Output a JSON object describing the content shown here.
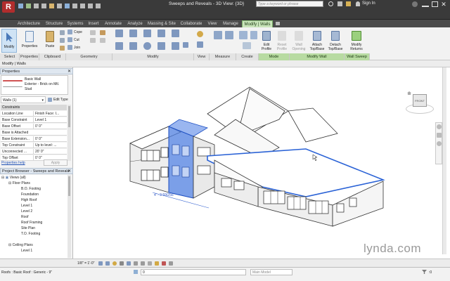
{
  "app": {
    "title": "Sweeps and Reveals - 3D View: {3D}",
    "search_placeholder": "Type a keyword or phrase",
    "sign_in": "Sign In"
  },
  "tabs": [
    "Architecture",
    "Structure",
    "Systems",
    "Insert",
    "Annotate",
    "Analyze",
    "Massing & Site",
    "Collaborate",
    "View",
    "Manage",
    "Modify | Walls"
  ],
  "ribbon": {
    "select": {
      "modify": "Modify",
      "group": "Select"
    },
    "properties": {
      "label": "Properties",
      "group": "Properties"
    },
    "clipboard": {
      "paste": "Paste",
      "group": "Clipboard"
    },
    "geometry": {
      "cope": "Cope",
      "cut": "Cut",
      "join": "Join",
      "group": "Geometry"
    },
    "modify_group": "Modify",
    "view_group": "View",
    "measure_group": "Measure",
    "create_group": "Create",
    "mode": {
      "edit_profile": "Edit Profile",
      "reset_profile": "Reset Profile",
      "group": "Mode"
    },
    "modify_wall": {
      "wall_opening": "Wall Opening",
      "attach": "Attach Top/Base",
      "detach": "Detach Top/Base",
      "group": "Modify Wall"
    },
    "wall_sweep": {
      "returns": "Modify Returns",
      "group": "Wall Sweep"
    }
  },
  "options_bar": "Modify | Walls",
  "properties_panel": {
    "title": "Properties",
    "type_name": "Basic Wall",
    "type_sub1": "Exterior - Brick on Mtl.",
    "type_sub2": "Stud",
    "selector": "Walls (1)",
    "edit_type": "Edit Type",
    "section": "Constraints",
    "rows": [
      {
        "k": "Location Line",
        "v": "Finish Face: I..."
      },
      {
        "k": "Base Constraint",
        "v": "Level 1"
      },
      {
        "k": "Base Offset",
        "v": "0' 0\""
      },
      {
        "k": "Base is Attached",
        "v": ""
      },
      {
        "k": "Base Extension...",
        "v": "0' 0\""
      },
      {
        "k": "Top Constraint",
        "v": "Up to level: ..."
      },
      {
        "k": "Unconnected ...",
        "v": "20' 0\""
      },
      {
        "k": "Top Offset",
        "v": "0' 0\""
      }
    ],
    "help": "Properties help",
    "apply": "Apply"
  },
  "project_browser": {
    "title": "Project Browser - Sweeps and Reveals",
    "views": "Views (all)",
    "floor_plans": "Floor Plans",
    "floor_plan_items": [
      "B.O. Footing",
      "Foundation",
      "High Roof",
      "Level 1",
      "Level 2",
      "Roof",
      "Roof Framing",
      "Site Plan",
      "T.O. Footing"
    ],
    "ceiling_plans": "Ceiling Plans",
    "ceiling_items": [
      "Level 1"
    ]
  },
  "viewcube": {
    "face": "FRONT"
  },
  "viewport": {
    "scale": "1/8\" = 1'-0\"",
    "dimension": "4' - 3 59/256\""
  },
  "status": {
    "text": "Roofs : Basic Roof : Generic - 9\"",
    "workset": "0",
    "model": "Main Model"
  },
  "watermark": "lynda.com",
  "colors": {
    "select_blue": "#3d6fd6",
    "context_green": "#8fc46b",
    "dark_bar": "#3a3a3a"
  }
}
